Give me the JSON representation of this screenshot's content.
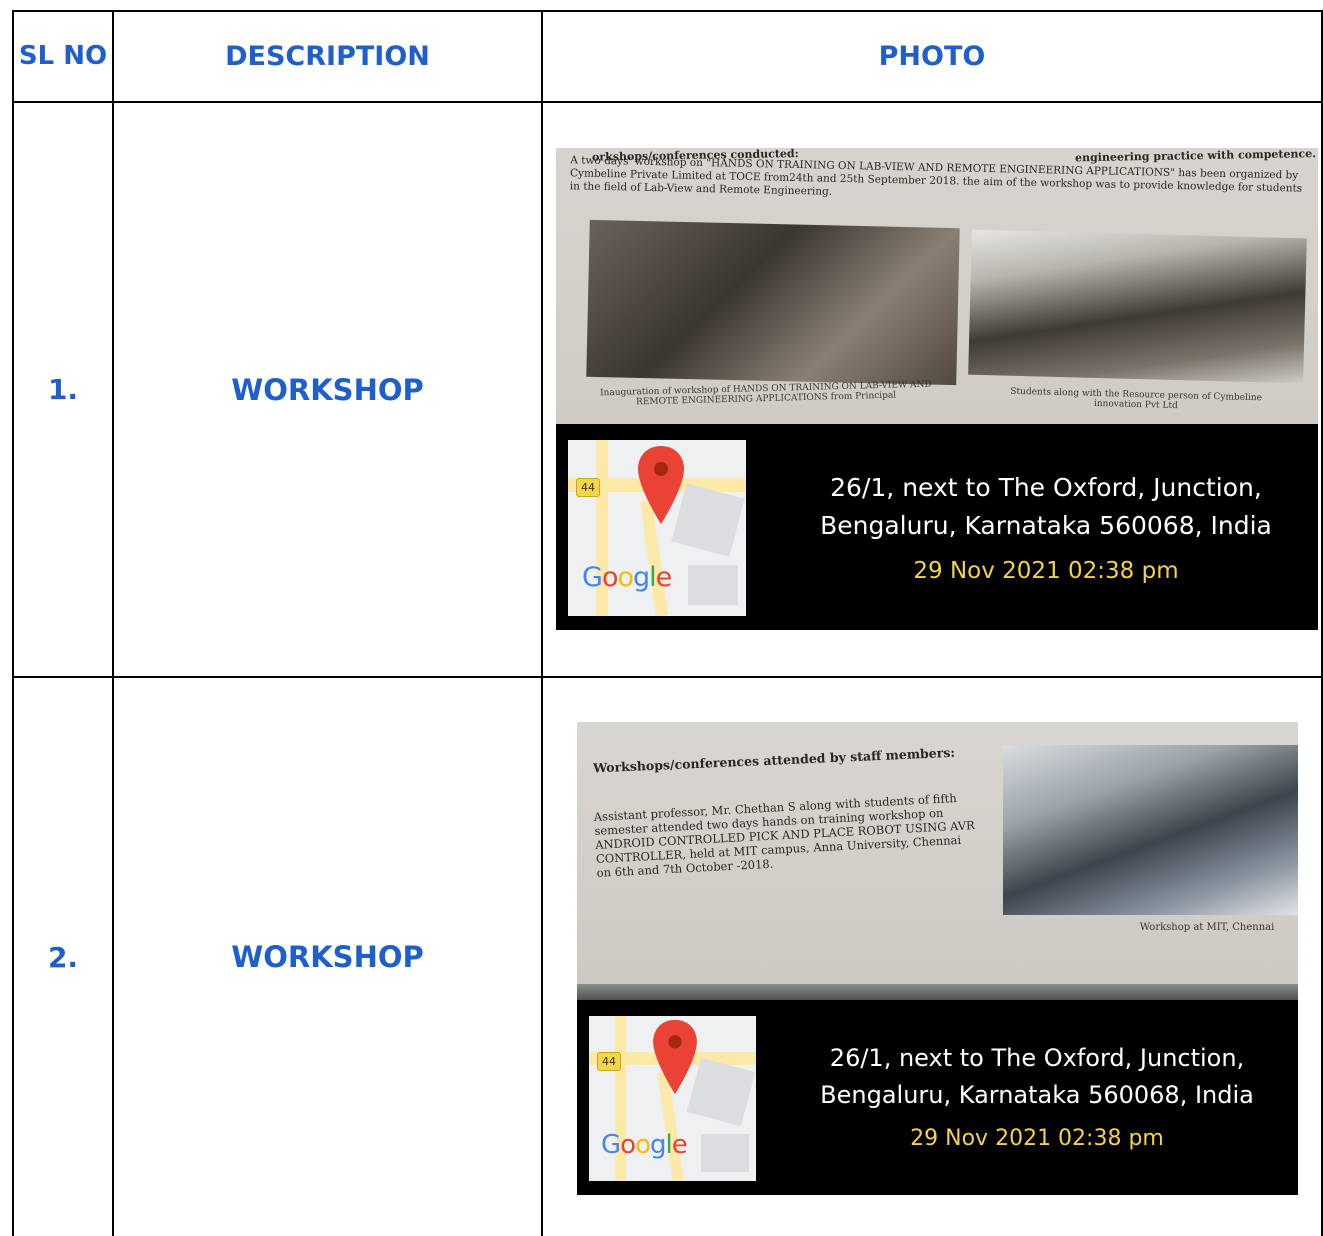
{
  "table": {
    "headers": {
      "sl_no": "SL NO",
      "description": "DESCRIPTION",
      "photo": "PHOTO"
    },
    "rows": [
      {
        "sl_no": "1.",
        "description": "WORKSHOP",
        "photo": {
          "section_heading": "orkshops/conferences conducted:",
          "top_right_fragment": "engineering practice with competence.",
          "body_text": "A two days' workshop on \"HANDS ON TRAINING ON LAB-VIEW AND REMOTE ENGINEERING APPLICATIONS\" has been organized by Cymbeline Private Limited at TOCE from24th and 25th September 2018. the aim of the workshop was to provide knowledge for students in the field of Lab-View and Remote Engineering.",
          "caption_left": "Inauguration of workshop of HANDS ON TRAINING ON LAB-VIEW AND REMOTE ENGINEERING APPLICATIONS from Principal",
          "caption_right": "Students along with the Resource person of Cymbeline innovation Pvt Ltd",
          "geotag": {
            "map_badge": "44",
            "map_brand": "Google",
            "address_line1": "26/1, next to The Oxford, Junction,",
            "address_line2": "Bengaluru, Karnataka 560068, India",
            "datetime": "29 Nov 2021 02:38 pm"
          }
        }
      },
      {
        "sl_no": "2.",
        "description": "WORKSHOP",
        "photo": {
          "section_heading": "Workshops/conferences attended by staff members:",
          "body_text": "Assistant professor, Mr. Chethan S along with students of fifth semester attended two days hands on training workshop on ANDROID CONTROLLED PICK AND PLACE ROBOT USING AVR CONTROLLER, held at MIT campus, Anna University, Chennai on 6th and 7th October -2018.",
          "caption": "Workshop at MIT, Chennai",
          "geotag": {
            "map_badge": "44",
            "map_brand": "Google",
            "address_line1": "26/1, next to The Oxford, Junction,",
            "address_line2": "Bengaluru, Karnataka 560068, India",
            "datetime": "29 Nov 2021 02:38 pm"
          }
        }
      }
    ]
  },
  "colors": {
    "header_text": "#1f5fcc",
    "geotag_date": "#f2d24e",
    "google_blue": "#4285f4",
    "google_red": "#ea4335",
    "google_yellow": "#fbbc05",
    "google_green": "#34a853"
  }
}
